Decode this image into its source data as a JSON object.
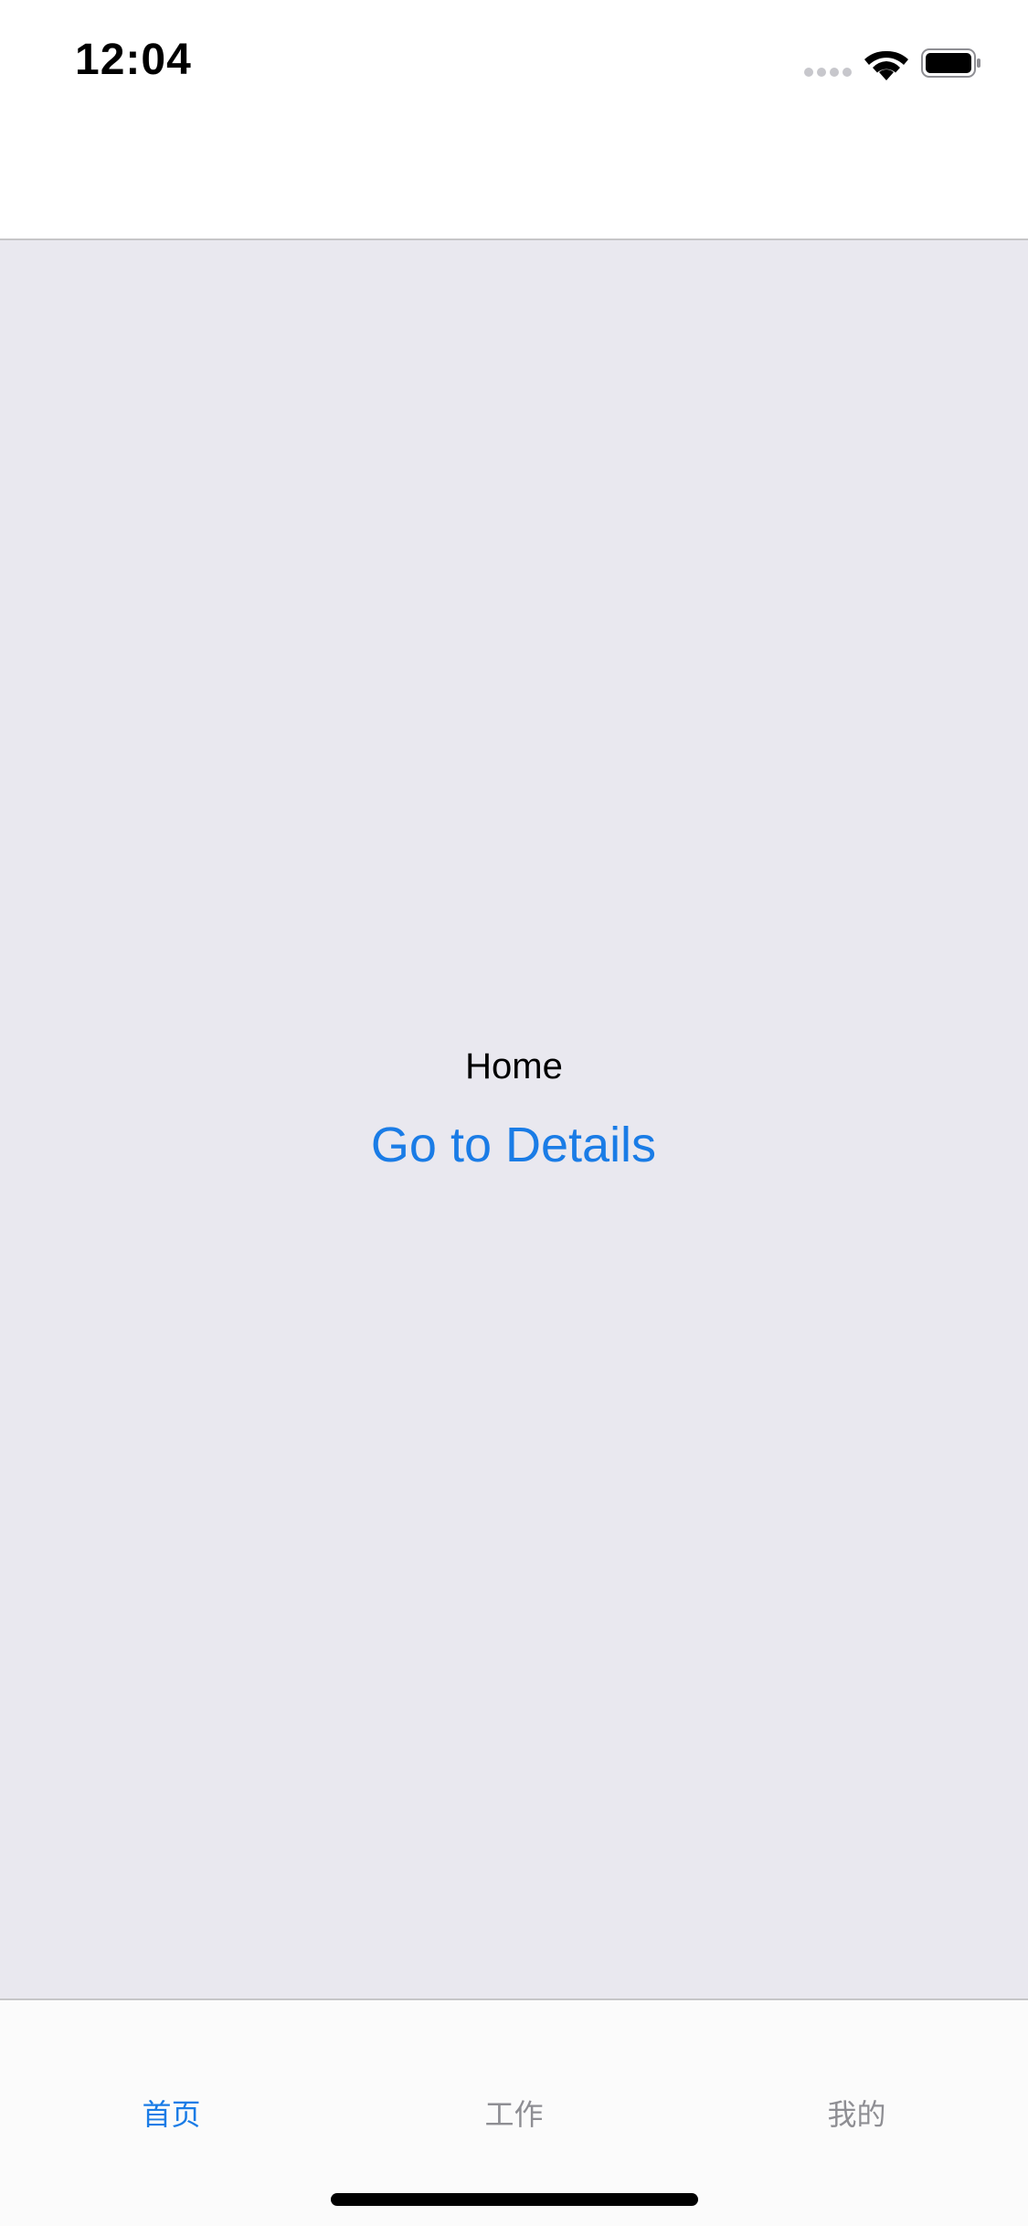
{
  "status_bar": {
    "time": "12:04",
    "signal_icon": "cellular-signal-icon",
    "wifi_icon": "wifi-icon",
    "battery_icon": "battery-icon"
  },
  "content": {
    "title": "Home",
    "button_label": "Go to Details"
  },
  "tab_bar": {
    "tabs": [
      {
        "label": "首页",
        "active": true
      },
      {
        "label": "工作",
        "active": false
      },
      {
        "label": "我的",
        "active": false
      }
    ]
  },
  "colors": {
    "accent": "#1a7ce6",
    "content_background": "#e9e8ef",
    "inactive_tab": "#8e8e93"
  }
}
